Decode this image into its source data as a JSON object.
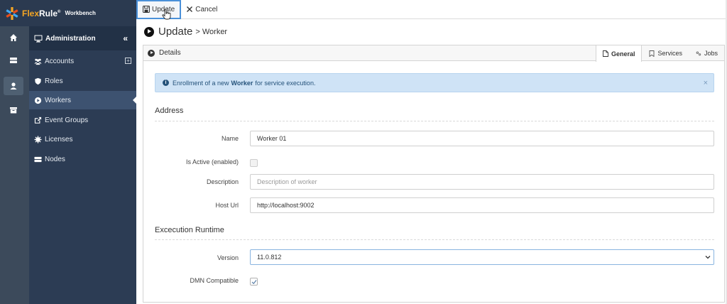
{
  "brand": {
    "name_a": "Flex",
    "name_b": "Rule",
    "reg": "®",
    "sub": "Workbench"
  },
  "colors": {
    "rail": "#3c4a5b",
    "sidebar": "#2c3c54",
    "accent": "#f5a623",
    "alert_bg": "#cfe3f6",
    "alert_text": "#24527a",
    "focus": "#4a90d9"
  },
  "rail": [
    {
      "icon": "home-icon"
    },
    {
      "icon": "server-icon"
    },
    {
      "icon": "user-icon",
      "active": true
    },
    {
      "icon": "archive-icon"
    }
  ],
  "sidebar": {
    "header": "Administration",
    "collapse": "«",
    "items": [
      {
        "label": "Accounts",
        "icon": "users-icon",
        "expand": "+"
      },
      {
        "label": "Roles",
        "icon": "shield-icon"
      },
      {
        "label": "Workers",
        "icon": "play-circle-icon",
        "active": true
      },
      {
        "label": "Event Groups",
        "icon": "external-link-icon"
      },
      {
        "label": "Licenses",
        "icon": "certificate-icon"
      },
      {
        "label": "Nodes",
        "icon": "server-icon"
      }
    ]
  },
  "toolbar": {
    "update_label": "Update",
    "cancel_label": "Cancel"
  },
  "page": {
    "title": "Update",
    "subtitle": "> Worker"
  },
  "panel": {
    "header": "Details",
    "tabs": [
      {
        "label": "General",
        "icon": "file-icon",
        "active": true
      },
      {
        "label": "Services",
        "icon": "bookmark-icon"
      },
      {
        "label": "Jobs",
        "icon": "gears-icon"
      }
    ]
  },
  "alert": {
    "prefix": "Enrollment of a new",
    "bold": "Worker",
    "suffix": "for service execution.",
    "close": "×"
  },
  "sections": {
    "address": "Address",
    "runtime": "Excecution Runtime"
  },
  "form": {
    "name_label": "Name",
    "name_value": "Worker 01",
    "active_label": "Is Active (enabled)",
    "active_checked": false,
    "description_label": "Description",
    "description_placeholder": "Description of worker",
    "host_label": "Host Url",
    "host_value": "http://localhost:9002",
    "version_label": "Version",
    "version_value": "11.0.812",
    "dmn_label": "DMN Compatible",
    "dmn_checked": true
  }
}
